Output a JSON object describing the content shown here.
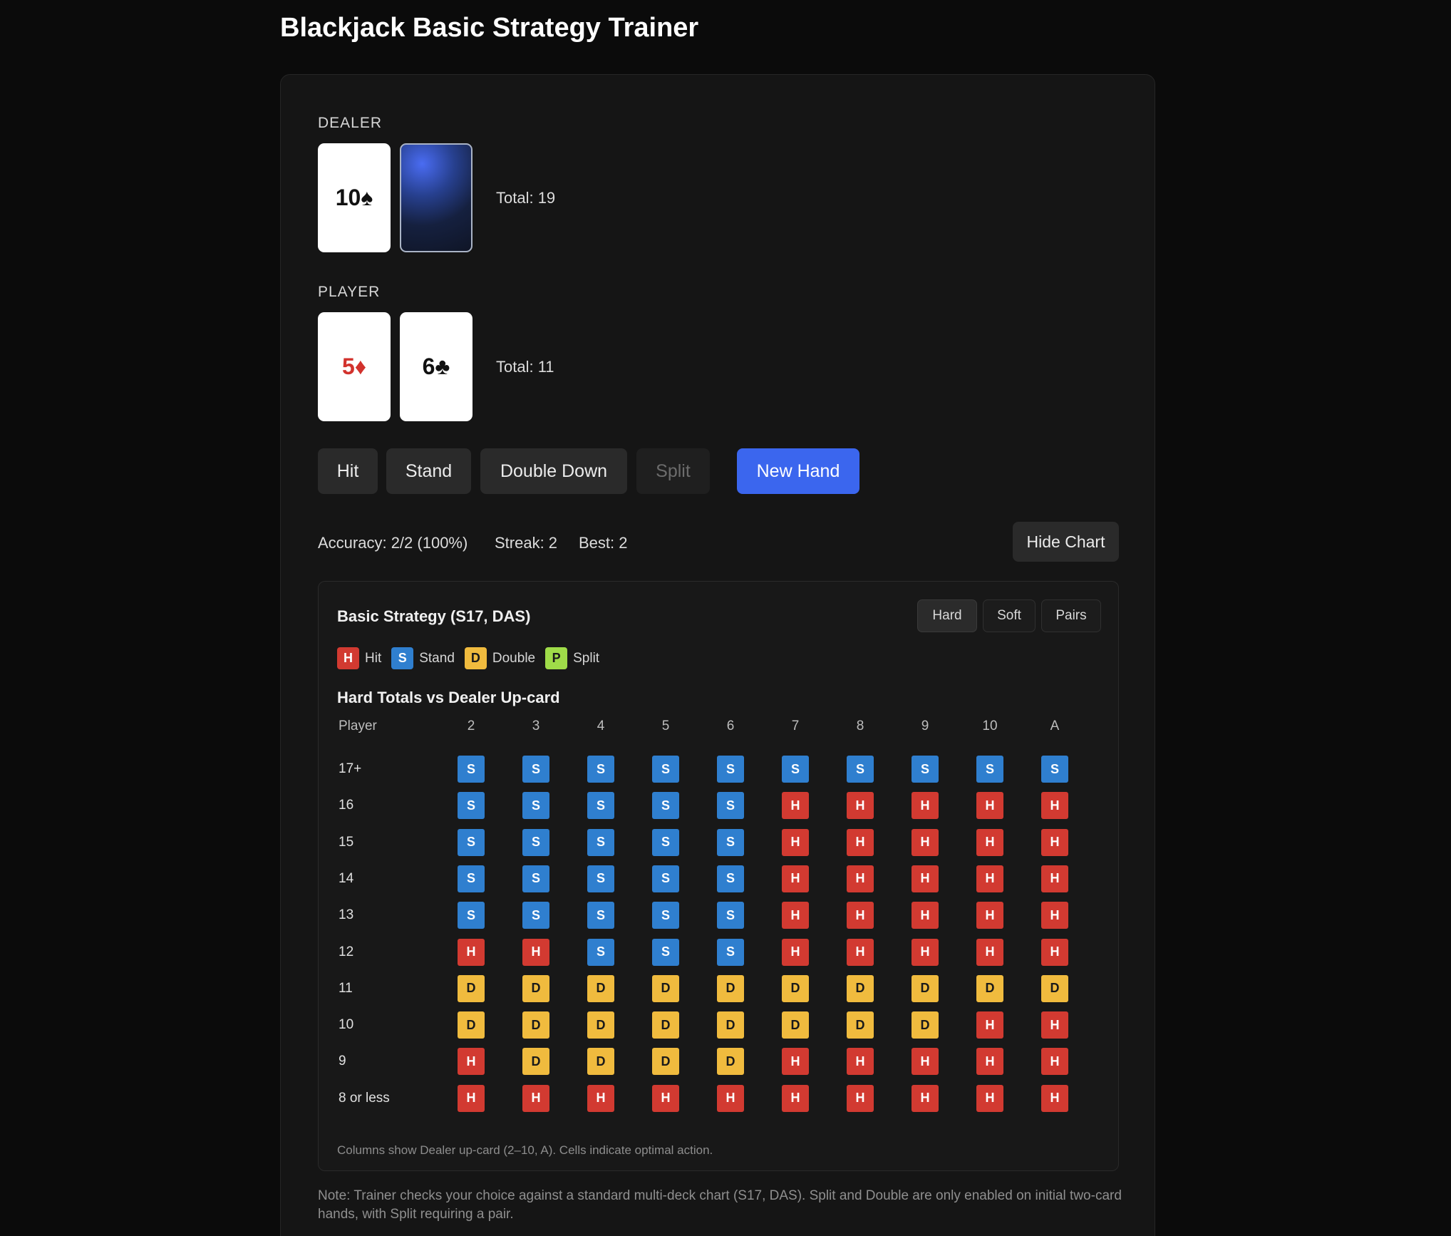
{
  "title": "Blackjack Basic Strategy Trainer",
  "dealer": {
    "label": "DEALER",
    "cards": [
      {
        "text": "10♠",
        "suit_color": "black",
        "face_down": false
      },
      {
        "text": "",
        "face_down": true
      }
    ],
    "total": "Total: 19"
  },
  "player": {
    "label": "PLAYER",
    "cards": [
      {
        "text": "5♦",
        "suit_color": "red",
        "face_down": false
      },
      {
        "text": "6♣",
        "suit_color": "black",
        "face_down": false
      }
    ],
    "total": "Total: 11"
  },
  "actions": {
    "hit": "Hit",
    "stand": "Stand",
    "double": "Double Down",
    "split": "Split",
    "new_hand": "New Hand"
  },
  "stats": {
    "accuracy": "Accuracy: 2/2 (100%)",
    "streak": "Streak: 2",
    "best": "Best: 2",
    "toggle_chart": "Hide Chart"
  },
  "chart": {
    "title": "Basic Strategy (S17, DAS)",
    "tabs": [
      "Hard",
      "Soft",
      "Pairs"
    ],
    "active_tab": "Hard",
    "legend": [
      {
        "code": "H",
        "label": "Hit"
      },
      {
        "code": "S",
        "label": "Stand"
      },
      {
        "code": "D",
        "label": "Double"
      },
      {
        "code": "P",
        "label": "Split"
      }
    ],
    "subtitle": "Hard Totals vs Dealer Up-card",
    "corner_label": "Player",
    "columns": [
      "2",
      "3",
      "4",
      "5",
      "6",
      "7",
      "8",
      "9",
      "10",
      "A"
    ],
    "rows": [
      {
        "label": "17+",
        "cells": [
          "S",
          "S",
          "S",
          "S",
          "S",
          "S",
          "S",
          "S",
          "S",
          "S"
        ]
      },
      {
        "label": "16",
        "cells": [
          "S",
          "S",
          "S",
          "S",
          "S",
          "H",
          "H",
          "H",
          "H",
          "H"
        ]
      },
      {
        "label": "15",
        "cells": [
          "S",
          "S",
          "S",
          "S",
          "S",
          "H",
          "H",
          "H",
          "H",
          "H"
        ]
      },
      {
        "label": "14",
        "cells": [
          "S",
          "S",
          "S",
          "S",
          "S",
          "H",
          "H",
          "H",
          "H",
          "H"
        ]
      },
      {
        "label": "13",
        "cells": [
          "S",
          "S",
          "S",
          "S",
          "S",
          "H",
          "H",
          "H",
          "H",
          "H"
        ]
      },
      {
        "label": "12",
        "cells": [
          "H",
          "H",
          "S",
          "S",
          "S",
          "H",
          "H",
          "H",
          "H",
          "H"
        ]
      },
      {
        "label": "11",
        "cells": [
          "D",
          "D",
          "D",
          "D",
          "D",
          "D",
          "D",
          "D",
          "D",
          "D"
        ]
      },
      {
        "label": "10",
        "cells": [
          "D",
          "D",
          "D",
          "D",
          "D",
          "D",
          "D",
          "D",
          "H",
          "H"
        ]
      },
      {
        "label": "9",
        "cells": [
          "H",
          "D",
          "D",
          "D",
          "D",
          "H",
          "H",
          "H",
          "H",
          "H"
        ]
      },
      {
        "label": "8 or less",
        "cells": [
          "H",
          "H",
          "H",
          "H",
          "H",
          "H",
          "H",
          "H",
          "H",
          "H"
        ]
      }
    ],
    "footnote": "Columns show Dealer up-card (2–10, A). Cells indicate optimal action."
  },
  "note": "Note: Trainer checks your choice against a standard multi-deck chart (S17, DAS). Split and Double are only enabled on initial two-card hands, with Split requiring a pair.",
  "colors": {
    "hit": "#d23a31",
    "stand": "#2f7fcf",
    "double": "#f0bb3e",
    "split": "#9fdc49",
    "primary": "#3b66ee"
  }
}
